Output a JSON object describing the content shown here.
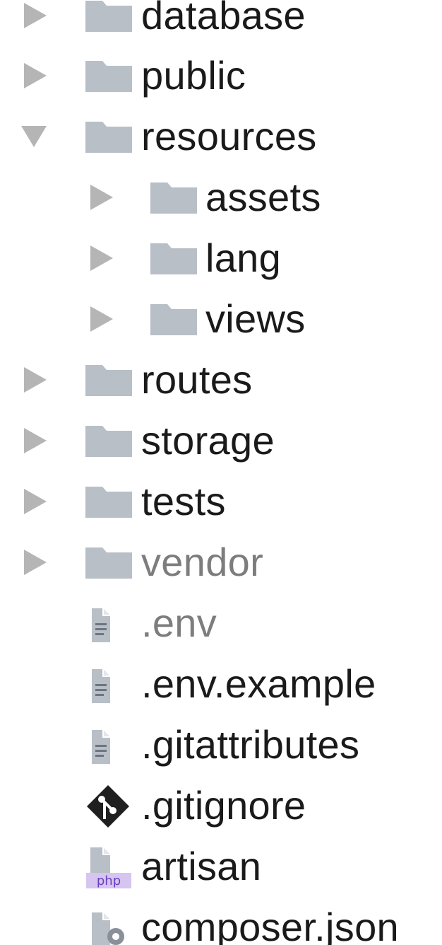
{
  "file_tree": {
    "items": [
      {
        "label": "database",
        "kind": "folder",
        "state": "collapsed",
        "depth": 0,
        "dimmed": false
      },
      {
        "label": "public",
        "kind": "folder",
        "state": "collapsed",
        "depth": 0,
        "dimmed": false
      },
      {
        "label": "resources",
        "kind": "folder",
        "state": "expanded",
        "depth": 0,
        "dimmed": false
      },
      {
        "label": "assets",
        "kind": "folder",
        "state": "collapsed",
        "depth": 1,
        "dimmed": false
      },
      {
        "label": "lang",
        "kind": "folder",
        "state": "collapsed",
        "depth": 1,
        "dimmed": false
      },
      {
        "label": "views",
        "kind": "folder",
        "state": "collapsed",
        "depth": 1,
        "dimmed": false
      },
      {
        "label": "routes",
        "kind": "folder",
        "state": "collapsed",
        "depth": 0,
        "dimmed": false
      },
      {
        "label": "storage",
        "kind": "folder",
        "state": "collapsed",
        "depth": 0,
        "dimmed": false
      },
      {
        "label": "tests",
        "kind": "folder",
        "state": "collapsed",
        "depth": 0,
        "dimmed": false
      },
      {
        "label": "vendor",
        "kind": "folder",
        "state": "collapsed",
        "depth": 0,
        "dimmed": true
      },
      {
        "label": ".env",
        "kind": "file",
        "icon": "text-file-icon",
        "depth": 0,
        "dimmed": true
      },
      {
        "label": ".env.example",
        "kind": "file",
        "icon": "text-file-icon",
        "depth": 0,
        "dimmed": false
      },
      {
        "label": ".gitattributes",
        "kind": "file",
        "icon": "text-file-icon",
        "depth": 0,
        "dimmed": false
      },
      {
        "label": ".gitignore",
        "kind": "file",
        "icon": "git-icon",
        "depth": 0,
        "dimmed": false
      },
      {
        "label": "artisan",
        "kind": "file",
        "icon": "php-file-icon",
        "badge": "php",
        "depth": 0,
        "dimmed": false
      },
      {
        "label": "composer.json",
        "kind": "file",
        "icon": "json-file-icon",
        "depth": 0,
        "dimmed": false
      }
    ]
  },
  "colors": {
    "text": "#1a1a1a",
    "text_dimmed": "#7d7d7d",
    "folder": "#b9bfc7",
    "disclosure_arrow": "#b5b5b5",
    "php_badge_bg": "#d5c5f0",
    "php_badge_text": "#6a3fbf"
  }
}
